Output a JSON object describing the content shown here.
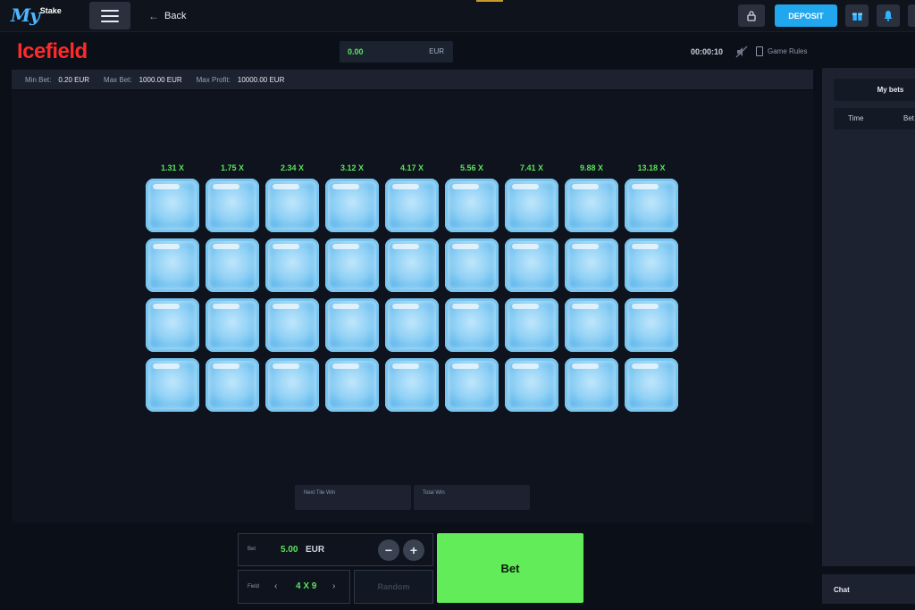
{
  "header": {
    "logo_my": "My",
    "logo_stake": "Stake",
    "back_label": "Back",
    "deposit_label": "DEPOSIT"
  },
  "game": {
    "title": "Icefield",
    "balance_value": "0.00",
    "balance_currency": "EUR",
    "timer": "00:00:10",
    "rules_label": "Game Rules"
  },
  "limits": {
    "min_bet_label": "Min Bet:",
    "min_bet_value": "0.20 EUR",
    "max_bet_label": "Max Bet:",
    "max_bet_value": "1000.00 EUR",
    "max_profit_label": "Max Profit:",
    "max_profit_value": "10000.00 EUR"
  },
  "multipliers": [
    "1.31 X",
    "1.75 X",
    "2.34 X",
    "3.12 X",
    "4.17 X",
    "5.56 X",
    "7.41 X",
    "9.88 X",
    "13.18 X"
  ],
  "grid": {
    "rows": 4,
    "cols": 9
  },
  "stats": {
    "next_tile_win_label": "Next Tile Win",
    "total_win_label": "Total Win"
  },
  "controls": {
    "bet_label": "Bet",
    "bet_value": "5.00",
    "bet_currency": "EUR",
    "minus_label": "−",
    "plus_label": "+",
    "field_label": "Field",
    "field_prev": "‹",
    "field_value": "4 X 9",
    "field_next": "›",
    "random_label": "Random",
    "bet_button_label": "Bet"
  },
  "sidebar": {
    "my_bets_label": "My bets",
    "col_time": "Time",
    "col_bet": "Bet",
    "chat_label": "Chat"
  },
  "colors": {
    "accent_green": "#62ec5a",
    "accent_blue": "#20a7ee",
    "title_red": "#ff2a2a"
  }
}
